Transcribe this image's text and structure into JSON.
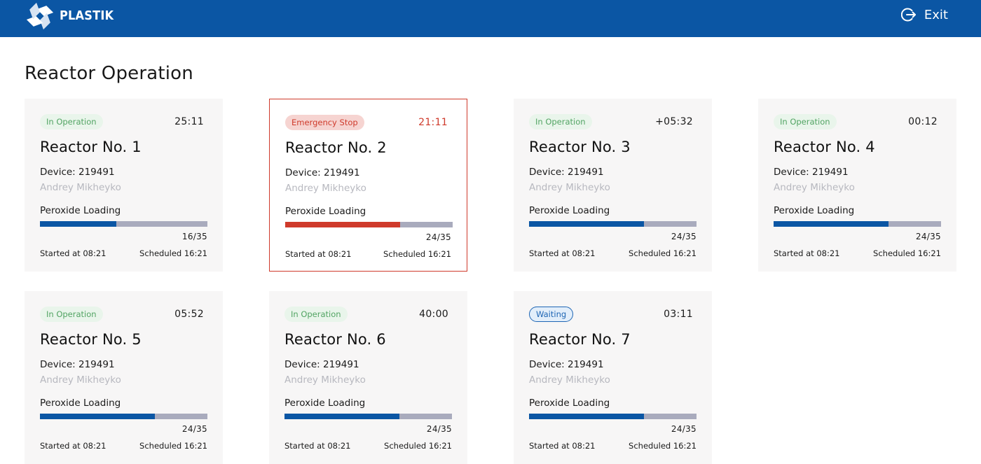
{
  "header": {
    "brand": "PLASTIK",
    "exit_label": "Exit"
  },
  "page": {
    "title": "Reactor Operation"
  },
  "reactors": [
    {
      "status": "In Operation",
      "status_kind": "op",
      "timer": "25:11",
      "name": "Reactor No. 1",
      "device": "Device: 219491",
      "operator": "Andrey Mikheyko",
      "stage": "Peroxide Loading",
      "progress_done": 16,
      "progress_total": 35,
      "progress_text": "16/35",
      "started": "Started at 08:21",
      "scheduled": "Scheduled 16:21"
    },
    {
      "status": "Emergency Stop",
      "status_kind": "stop",
      "timer": "21:11",
      "name": "Reactor No. 2",
      "device": "Device: 219491",
      "operator": "Andrey Mikheyko",
      "stage": "Peroxide Loading",
      "progress_done": 24,
      "progress_total": 35,
      "progress_text": "24/35",
      "started": "Started at 08:21",
      "scheduled": "Scheduled 16:21"
    },
    {
      "status": "In Operation",
      "status_kind": "op",
      "timer": "+05:32",
      "name": "Reactor No. 3",
      "device": "Device: 219491",
      "operator": "Andrey Mikheyko",
      "stage": "Peroxide Loading",
      "progress_done": 24,
      "progress_total": 35,
      "progress_text": "24/35",
      "started": "Started at 08:21",
      "scheduled": "Scheduled 16:21"
    },
    {
      "status": "In Operation",
      "status_kind": "op",
      "timer": "00:12",
      "name": "Reactor No. 4",
      "device": "Device: 219491",
      "operator": "Andrey Mikheyko",
      "stage": "Peroxide Loading",
      "progress_done": 24,
      "progress_total": 35,
      "progress_text": "24/35",
      "started": "Started at 08:21",
      "scheduled": "Scheduled 16:21"
    },
    {
      "status": "In Operation",
      "status_kind": "op",
      "timer": "05:52",
      "name": "Reactor No. 5",
      "device": "Device: 219491",
      "operator": "Andrey Mikheyko",
      "stage": "Peroxide Loading",
      "progress_done": 24,
      "progress_total": 35,
      "progress_text": "24/35",
      "started": "Started at 08:21",
      "scheduled": "Scheduled 16:21"
    },
    {
      "status": "In Operation",
      "status_kind": "op",
      "timer": "40:00",
      "name": "Reactor No. 6",
      "device": "Device: 219491",
      "operator": "Andrey Mikheyko",
      "stage": "Peroxide Loading",
      "progress_done": 24,
      "progress_total": 35,
      "progress_text": "24/35",
      "started": "Started at 08:21",
      "scheduled": "Scheduled 16:21"
    },
    {
      "status": "Waiting",
      "status_kind": "wait",
      "timer": "03:11",
      "name": "Reactor No. 7",
      "device": "Device: 219491",
      "operator": "Andrey Mikheyko",
      "stage": "Peroxide Loading",
      "progress_done": 24,
      "progress_total": 35,
      "progress_text": "24/35",
      "started": "Started at 08:21",
      "scheduled": "Scheduled 16:21"
    }
  ],
  "colors": {
    "brand_blue": "#0b56a4",
    "emergency_red": "#cf3a2b",
    "operation_green": "#52a463",
    "bar_track": "#a9abbd"
  },
  "icons": {
    "logo": "plastik-logo-icon",
    "exit": "exit-icon"
  }
}
